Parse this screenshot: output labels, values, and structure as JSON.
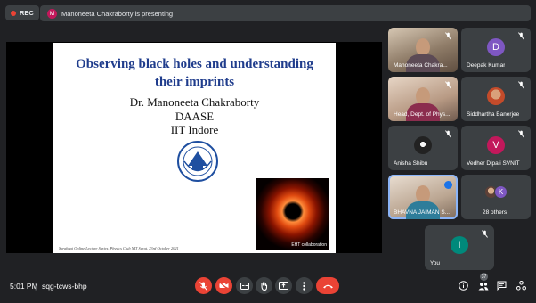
{
  "top_bar": {
    "rec_label": "REC",
    "presenter_initial": "M",
    "presenting_text": "Manoneeta Chakraborty is presenting"
  },
  "slide": {
    "title_line1": "Observing black holes and understanding",
    "title_line2": "their imprints",
    "author": "Dr. Manoneeta Chakraborty",
    "department": "DAASE",
    "institute": "IIT Indore",
    "image_caption": "EHT collaboration",
    "footer": "Sarabhai Online Lecture Series, Physics Club NIT Surat, 23rd October 2021"
  },
  "participants": [
    {
      "name": "Manoneeta Chakra...",
      "type": "video",
      "muted": true
    },
    {
      "name": "Deepak Kumar",
      "type": "avatar",
      "initial": "D",
      "color": "#7e57c2",
      "muted": true
    },
    {
      "name": "Head, Dept. of Phys...",
      "type": "video",
      "muted": true
    },
    {
      "name": "Siddhartha Banerjee",
      "type": "photo",
      "muted": true
    },
    {
      "name": "Anisha Shibu",
      "type": "photo",
      "muted": true
    },
    {
      "name": "Vedher Dipali SVNIT",
      "type": "avatar",
      "initial": "V",
      "color": "#c2185b",
      "muted": true
    },
    {
      "name": "BHAVNA JAIMAN S...",
      "type": "video",
      "muted": false,
      "active": true
    },
    {
      "name": "28 others",
      "type": "others",
      "initial": "K",
      "color": "#7e57c2"
    },
    {
      "name": "You",
      "type": "avatar",
      "initial": "I",
      "color": "#00897b",
      "muted": true
    }
  ],
  "bottom_bar": {
    "time": "5:01 PM",
    "separator": "|",
    "meeting_code": "sqg-tcws-bhp",
    "people_count": "37"
  },
  "colors": {
    "background": "#202124",
    "tile": "#3c4043",
    "danger": "#ea4335",
    "accent": "#8ab4f8"
  }
}
